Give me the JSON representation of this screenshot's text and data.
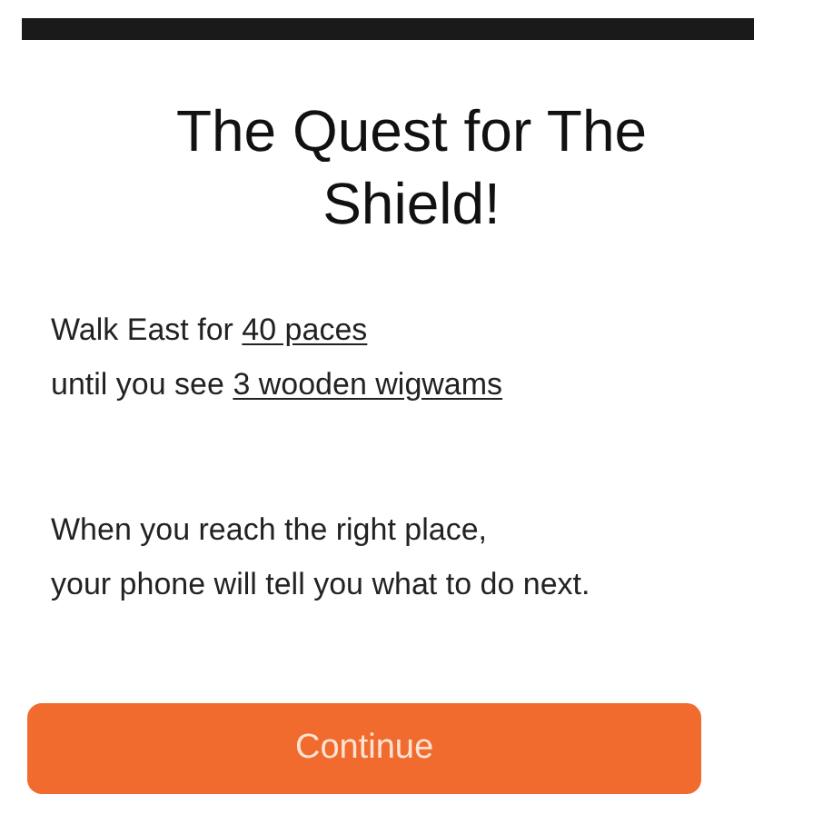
{
  "title": "The Quest for The Shield!",
  "instructions": [
    [
      {
        "text": "Walk East for ",
        "underline": false
      },
      {
        "text": "40 paces",
        "underline": true
      }
    ],
    [
      {
        "text": "until you see ",
        "underline": false
      },
      {
        "text": "3 wooden wigwams",
        "underline": true
      }
    ]
  ],
  "message": [
    "When you reach the right place,",
    "your phone will tell you what to do next."
  ],
  "button": "Continue"
}
